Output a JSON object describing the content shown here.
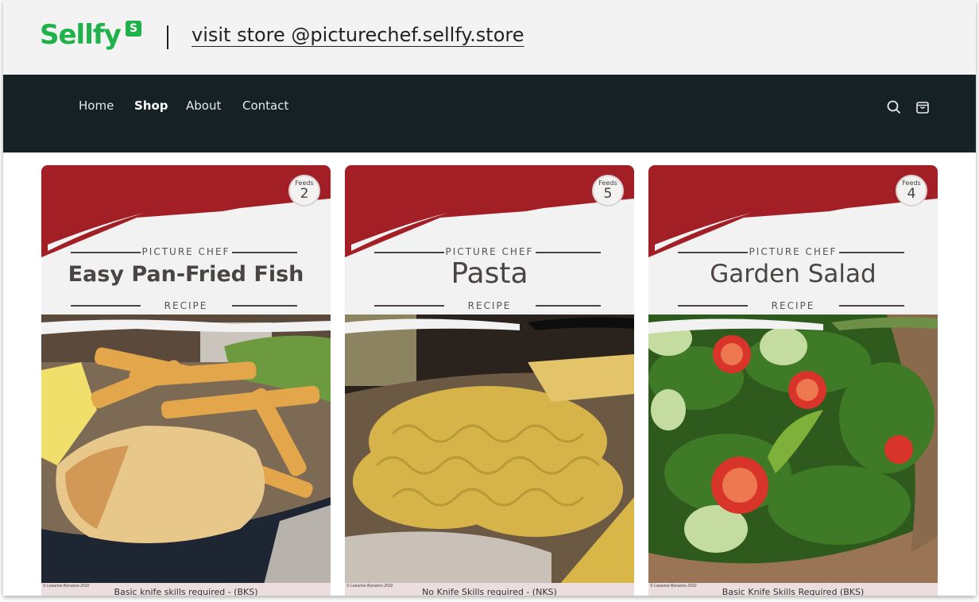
{
  "banner": {
    "logo_text": "Sellfy",
    "logo_badge": "S",
    "store_link": "visit store @picturechef.sellfy.store"
  },
  "nav": {
    "items": [
      {
        "label": "Home",
        "active": false
      },
      {
        "label": "Shop",
        "active": true
      },
      {
        "label": "About",
        "active": false
      },
      {
        "label": "Contact",
        "active": false
      }
    ],
    "icons": [
      "search-icon",
      "shopping-bag-icon"
    ]
  },
  "colors": {
    "brand_green": "#1fb24a",
    "navbar_bg": "#162126",
    "card_red": "#a31f26",
    "footer_pink": "#ecdedf"
  },
  "products": [
    {
      "brand": "PICTURE CHEF",
      "title": "Easy Pan-Fried Fish",
      "subtitle": "RECIPE",
      "feeds_label": "Feeds",
      "feeds": "2",
      "copyright": "© Leeanne Bonanno 2022",
      "skill": "Basic knife skills required - (BKS)",
      "image": "pan-fried fish with chips and lemon"
    },
    {
      "brand": "PICTURE CHEF",
      "title": "Pasta",
      "subtitle": "RECIPE",
      "feeds_label": "Feeds",
      "feeds": "5",
      "copyright": "© Leeanne Bonanno 2022",
      "skill": "No Knife Skills required - (NKS)",
      "image": "fusilli and penne pasta with flour"
    },
    {
      "brand": "PICTURE CHEF",
      "title": "Garden Salad",
      "subtitle": "RECIPE",
      "feeds_label": "Feeds",
      "feeds": "4",
      "copyright": "© Leeanne Bonanno 2022",
      "skill": "Basic Knife Skills Required (BKS)",
      "image": "spinach salad with tomatoes and cucumber"
    }
  ]
}
